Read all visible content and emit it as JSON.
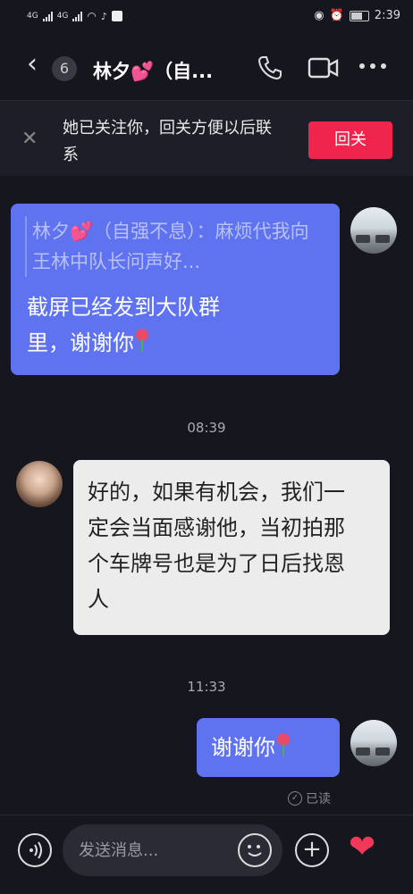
{
  "status_bar": {
    "signal_1": "4G",
    "signal_2": "4G",
    "time": "2:39"
  },
  "header": {
    "unread_count": "6",
    "title": "林夕💕（自..."
  },
  "follow_banner": {
    "text": "她已关注你，回关方便以后联系",
    "button_label": "回关"
  },
  "messages": [
    {
      "sender": "self",
      "quote": "林夕💕（自强不息）：麻烦代我向王林中队长问声好...",
      "text_line1": "截屏已经发到大队群",
      "text_line2": "里，谢谢你",
      "emoji": "rose"
    },
    {
      "timestamp": "08:39"
    },
    {
      "sender": "other",
      "text": "好的，如果有机会，我们一定会当面感谢他，当初拍那个车牌号也是为了日后找恩人"
    },
    {
      "timestamp": "11:33"
    },
    {
      "sender": "self",
      "text": "谢谢你",
      "emoji": "rose"
    }
  ],
  "read_status": "已读",
  "input_bar": {
    "placeholder": "发送消息..."
  },
  "colors": {
    "background": "#16161f",
    "self_bubble": "#5f73f0",
    "other_bubble": "#ececec",
    "accent": "#f0254d"
  }
}
